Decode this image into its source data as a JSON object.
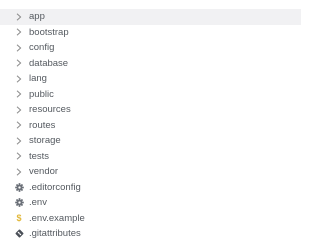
{
  "explorer": {
    "items": [
      {
        "type": "folder",
        "label": "app",
        "icon": "chevron-right-icon",
        "selected": true
      },
      {
        "type": "folder",
        "label": "bootstrap",
        "icon": "chevron-right-icon"
      },
      {
        "type": "folder",
        "label": "config",
        "icon": "chevron-right-icon"
      },
      {
        "type": "folder",
        "label": "database",
        "icon": "chevron-right-icon"
      },
      {
        "type": "folder",
        "label": "lang",
        "icon": "chevron-right-icon"
      },
      {
        "type": "folder",
        "label": "public",
        "icon": "chevron-right-icon"
      },
      {
        "type": "folder",
        "label": "resources",
        "icon": "chevron-right-icon"
      },
      {
        "type": "folder",
        "label": "routes",
        "icon": "chevron-right-icon"
      },
      {
        "type": "folder",
        "label": "storage",
        "icon": "chevron-right-icon"
      },
      {
        "type": "folder",
        "label": "tests",
        "icon": "chevron-right-icon"
      },
      {
        "type": "folder",
        "label": "vendor",
        "icon": "chevron-right-icon"
      },
      {
        "type": "file",
        "label": ".editorconfig",
        "icon": "gear-icon"
      },
      {
        "type": "file",
        "label": ".env",
        "icon": "gear-icon"
      },
      {
        "type": "file",
        "label": ".env.example",
        "icon": "dollar-icon"
      },
      {
        "type": "file",
        "label": ".gitattributes",
        "icon": "git-icon"
      }
    ]
  },
  "colors": {
    "selected_row_bg": "#f1f1f3",
    "text": "#555a60",
    "chevron": "#8a8a8a",
    "gear": "#6b7078",
    "dollar": "#e2b83a",
    "git": "#4a4f57"
  }
}
